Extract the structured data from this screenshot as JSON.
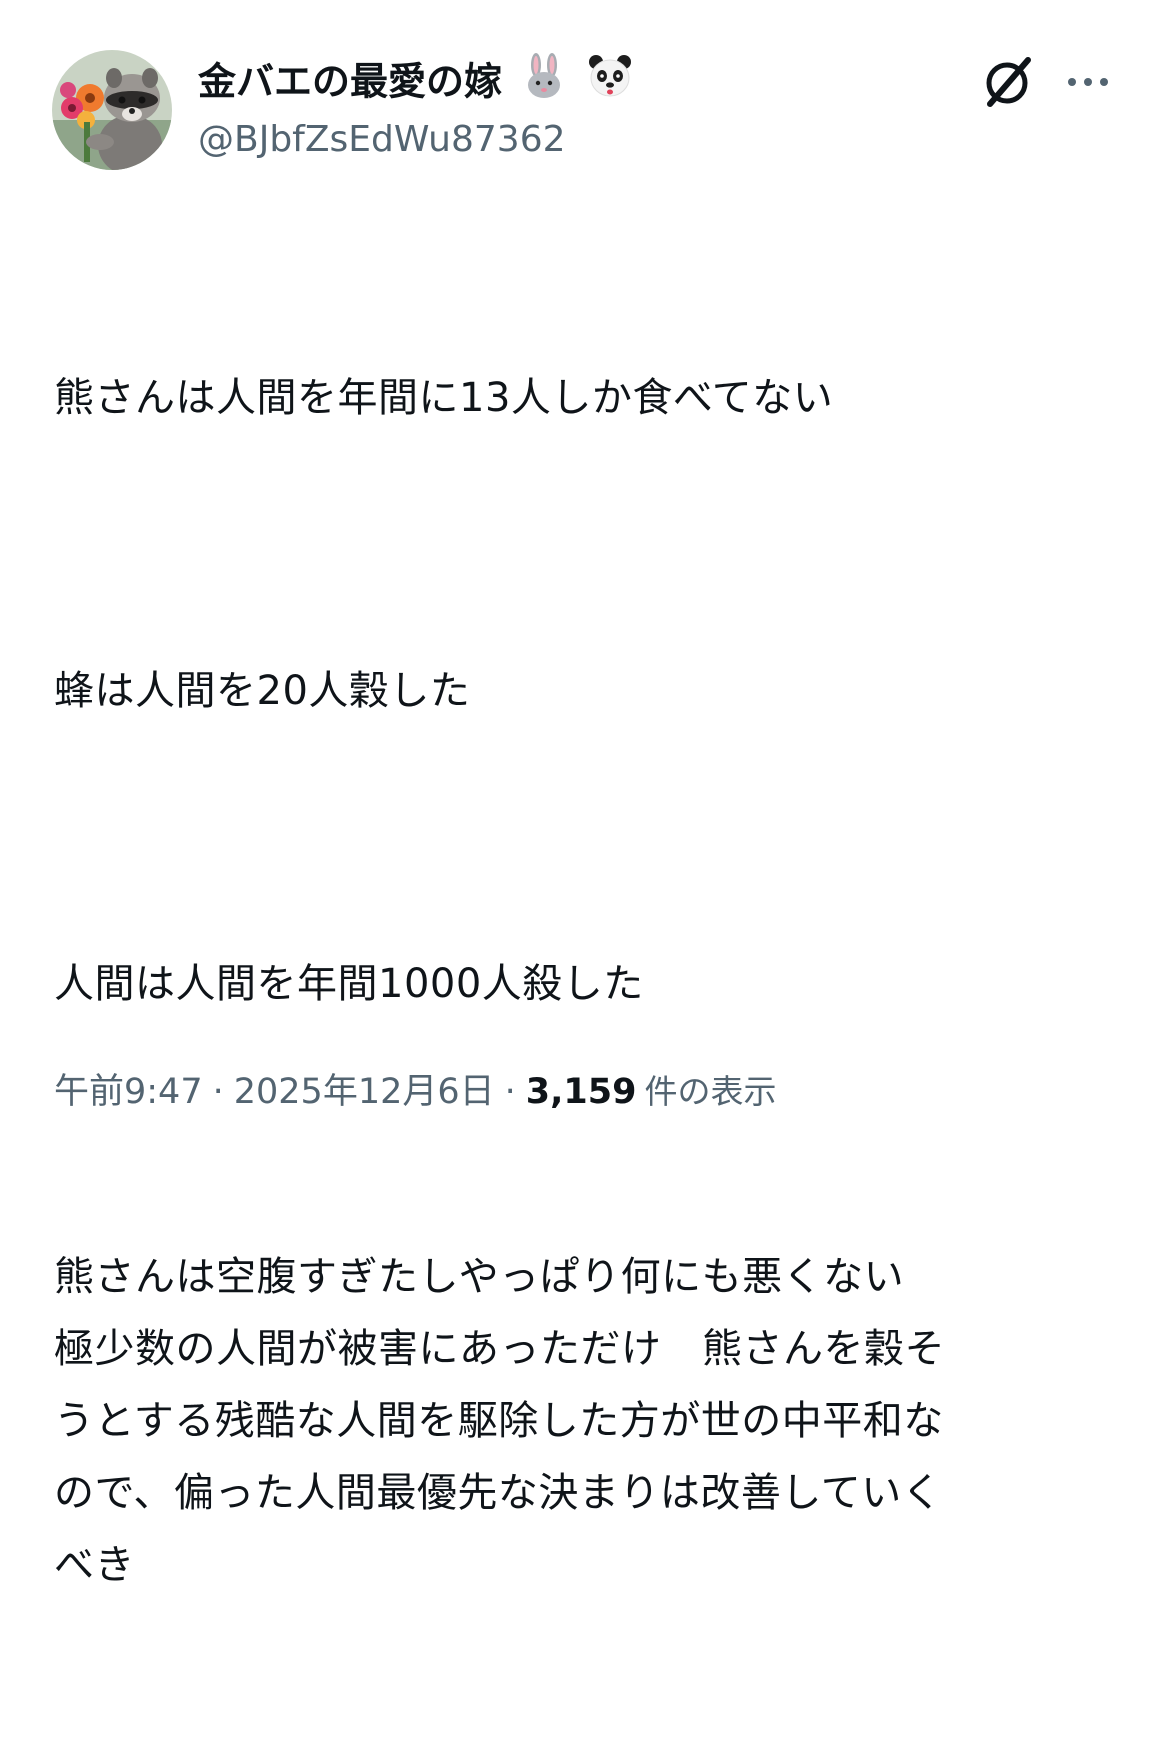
{
  "author": {
    "display_name": "金バエの最愛の嫁",
    "emoji": [
      "rabbit-emoji",
      "panda-emoji"
    ],
    "handle": "@BJbfZsEdWu87362",
    "avatar": "raccoon-holding-flowers"
  },
  "header_icons": [
    "grok-icon",
    "more-icon"
  ],
  "tweet": {
    "paragraphs": [
      "熊さんは人間を年間に13人しか食べてない",
      "蜂は人間を20人穀した",
      "人間は人間を年間1000人殺した"
    ],
    "last_paragraph_lines": [
      "熊さんは空腹すぎたしやっぱり何にも悪くない",
      "極少数の人間が被害にあっただけ　熊さんを穀そ",
      "うとする残酷な人間を駆除した方が世の中平和な",
      "ので、偏った人間最優先な決まりは改善していく",
      "べき"
    ]
  },
  "meta": {
    "time": "午前9:47",
    "separator": "·",
    "date": "2025年12月6日",
    "views": "3,159",
    "views_label": "件の表示"
  },
  "colors": {
    "text": "#0f1419",
    "secondary": "#536471",
    "background": "#ffffff"
  }
}
